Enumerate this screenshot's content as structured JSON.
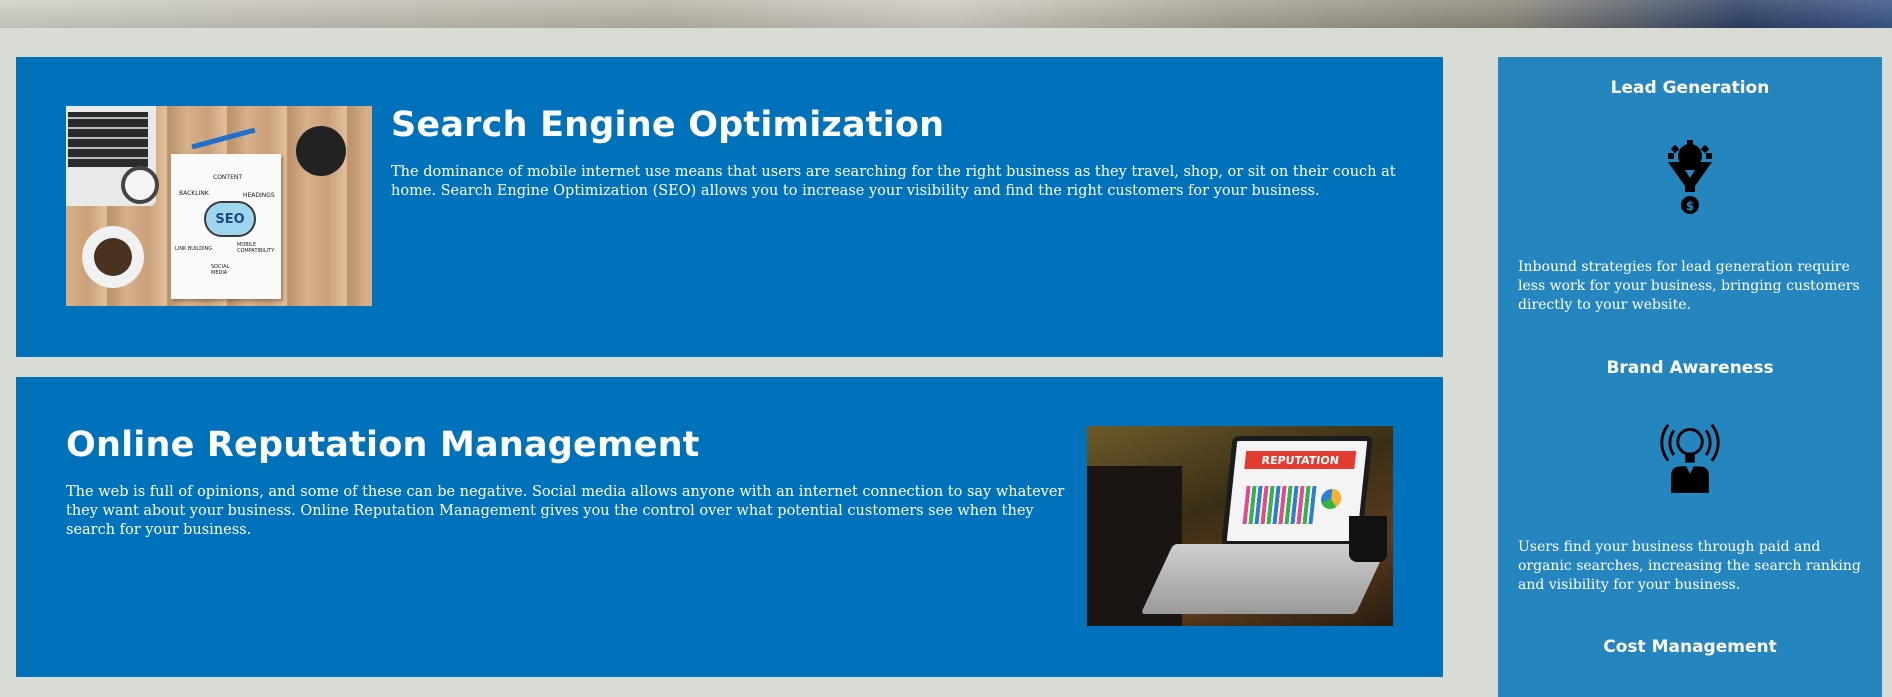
{
  "services": [
    {
      "title": "Search Engine Optimization",
      "description": "The dominance of mobile internet use means that users are searching for the right business as they travel, shop, or sit on their couch at home. Search Engine Optimization (SEO) allows you to increase your visibility and find the right customers for your business.",
      "image_text": {
        "cloud": "SEO",
        "labels": [
          "CONTENT",
          "HEADINGS",
          "BACKLINK",
          "LINK BUILDING",
          "MOBILE COMPATIBILITY",
          "SOCIAL MEDIA"
        ]
      }
    },
    {
      "title": "Online Reputation Management",
      "description": "The web is full of opinions, and some of these can be negative. Social media allows anyone with an internet connection to say whatever they want about your business. Online Reputation Management gives you the control over what potential customers see when they search for your business.",
      "image_text": {
        "banner": "REPUTATION"
      }
    }
  ],
  "sidebar": {
    "features": [
      {
        "title": "Lead Generation",
        "icon": "lead-funnel-icon",
        "description": "Inbound strategies for lead generation require less work for your business, bringing customers directly to your website."
      },
      {
        "title": "Brand Awareness",
        "icon": "lightbulb-broadcast-icon",
        "description": "Users find your business through paid and organic searches, increasing the search ranking and visibility for your business."
      },
      {
        "title": "Cost Management",
        "icon": "",
        "description": ""
      }
    ]
  },
  "colors": {
    "page_bg": "#d9dbd5",
    "service_bg": "#0072bb",
    "sidebar_bg": "#2485bf",
    "text": "#ffffff"
  }
}
